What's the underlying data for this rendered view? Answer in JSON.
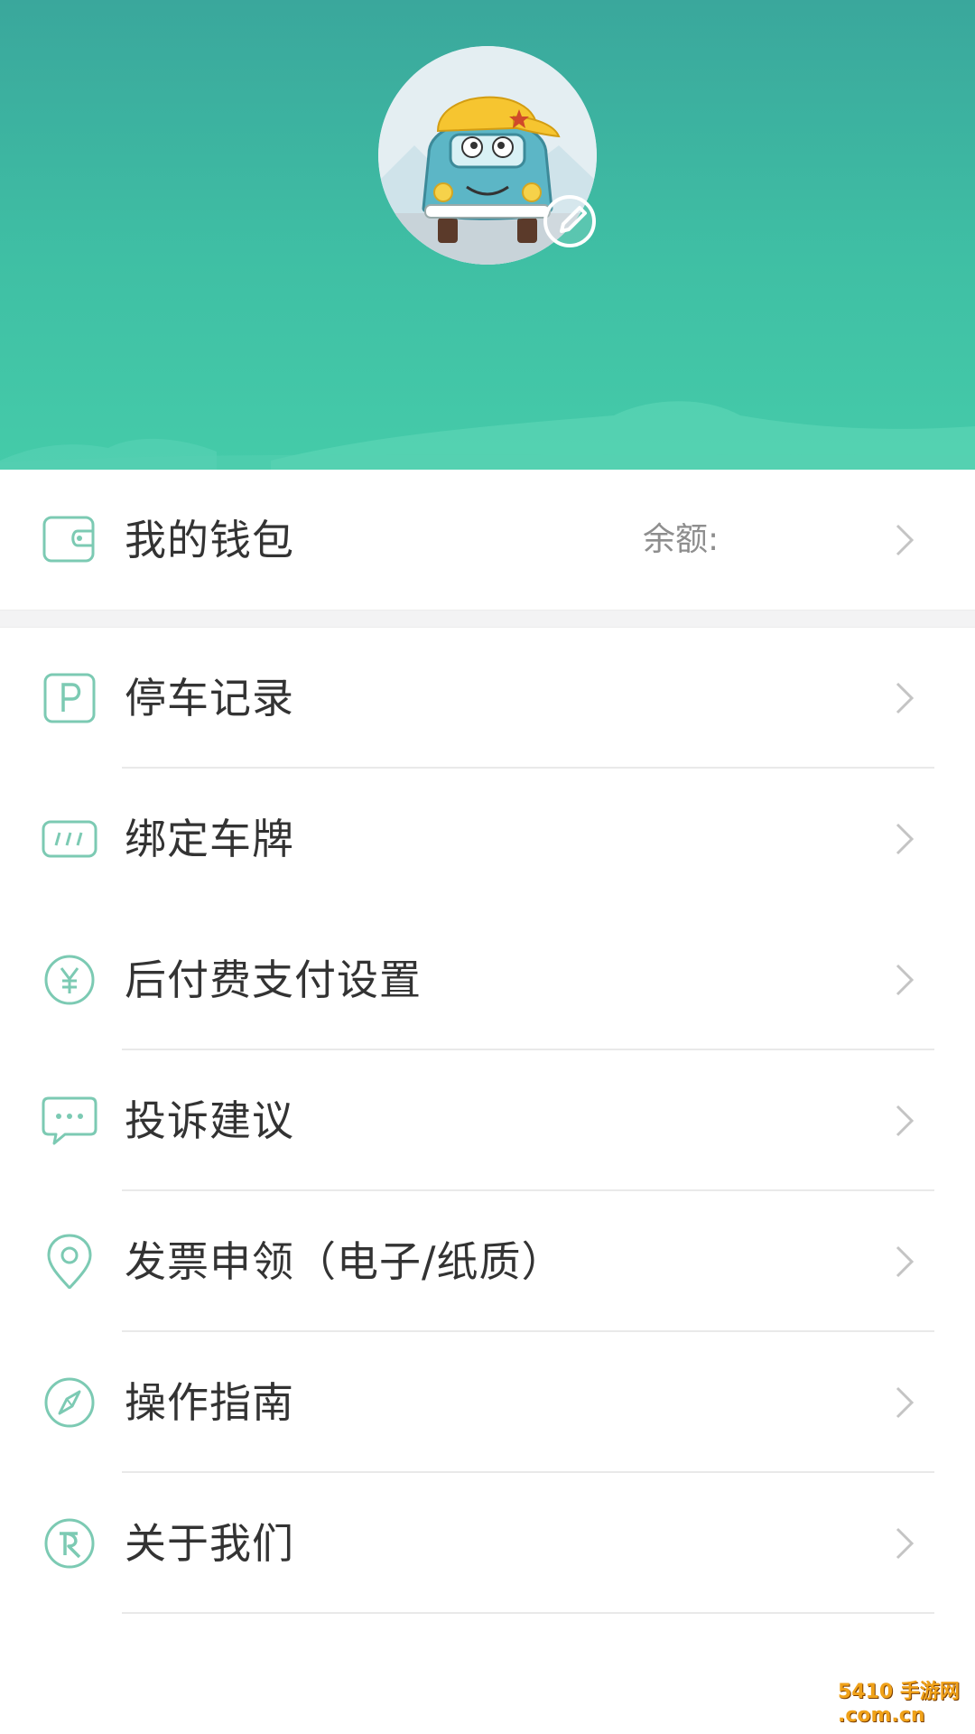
{
  "profile": {
    "avatar_icon": "car-mascot-avatar",
    "edit_icon": "edit-icon"
  },
  "wallet": {
    "label": "我的钱包",
    "balance_label": "余额:",
    "icon": "wallet-icon"
  },
  "menu": [
    {
      "label": "停车记录",
      "icon": "parking-icon"
    },
    {
      "label": "绑定车牌",
      "icon": "license-plate-icon"
    },
    {
      "label": "后付费支付设置",
      "icon": "yen-icon"
    },
    {
      "label": "投诉建议",
      "icon": "chat-bubble-icon"
    },
    {
      "label": "发票申领（电子/纸质）",
      "icon": "location-pin-icon"
    },
    {
      "label": "操作指南",
      "icon": "compass-icon"
    },
    {
      "label": "关于我们",
      "icon": "about-logo-icon"
    }
  ],
  "watermark": {
    "text": "5410 手游网 .com.cn"
  },
  "colors": {
    "header_top": "#3aa79c",
    "header_bottom": "#45cba9",
    "icon_accent": "#7ccab3",
    "text": "#333333",
    "muted": "#8e8e8e"
  }
}
